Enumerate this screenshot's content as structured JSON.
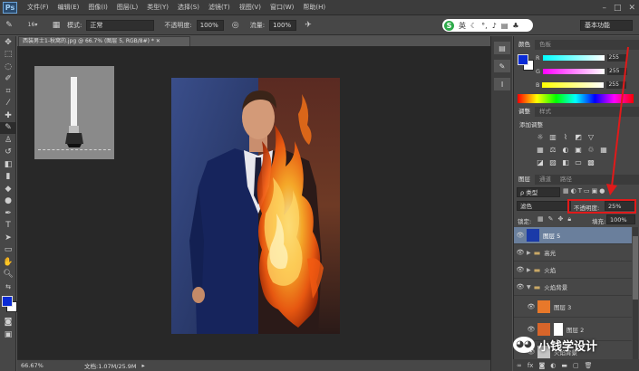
{
  "app": {
    "logo": "Ps"
  },
  "menu": [
    "文件(F)",
    "编辑(E)",
    "图像(I)",
    "图层(L)",
    "类型(Y)",
    "选择(S)",
    "滤镜(T)",
    "视图(V)",
    "窗口(W)",
    "帮助(H)"
  ],
  "window_controls": {
    "minimize": "–",
    "maximize": "□",
    "close": "✕"
  },
  "options": {
    "brush_size": "16",
    "mode_label": "模式:",
    "mode_value": "正常",
    "opacity_label": "不透明度:",
    "opacity_value": "100%",
    "flow_label": "流量:",
    "flow_value": "100%"
  },
  "ime": {
    "logo": "S",
    "label": "英"
  },
  "workspace": "基本功能",
  "document": {
    "tab_title": "西装男士1-秋窝的.jpg @ 66.7% (图层 5, RGB/8#) *",
    "zoom": "66.67%",
    "doc_size": "文档:1.07M/25.9M"
  },
  "color_panel": {
    "tabs": [
      "颜色",
      "色板"
    ],
    "r": {
      "label": "R",
      "value": "255"
    },
    "g": {
      "label": "G",
      "value": "255"
    },
    "b": {
      "label": "B",
      "value": "255"
    },
    "foreground": "#0a2bd6",
    "background": "#ffffff"
  },
  "adjustments_panel": {
    "tabs": [
      "调整",
      "样式"
    ],
    "title": "添加调整"
  },
  "layers_panel": {
    "tabs": [
      "图层",
      "通道",
      "路径"
    ],
    "filter_kind": "ρ 类型",
    "blend_mode": "滤色",
    "opacity_label": "不透明度:",
    "opacity_value": "25%",
    "lock_label": "锁定:",
    "fill_label": "填充:",
    "fill_value": "100%",
    "layers": [
      {
        "name": "图层 5",
        "kind": "layer",
        "selected": true
      },
      {
        "name": "高光",
        "kind": "group"
      },
      {
        "name": "火焰",
        "kind": "group"
      },
      {
        "name": "火焰背景",
        "kind": "group"
      },
      {
        "name": "图层 3",
        "kind": "layer"
      },
      {
        "name": "图层 2",
        "kind": "layer"
      },
      {
        "name": "火焰背景",
        "kind": "layer"
      }
    ]
  },
  "watermark": {
    "text": "小钱学设计"
  },
  "colors": {
    "accent_red": "#e01a1a",
    "selected_layer": "#6a7f9c"
  }
}
